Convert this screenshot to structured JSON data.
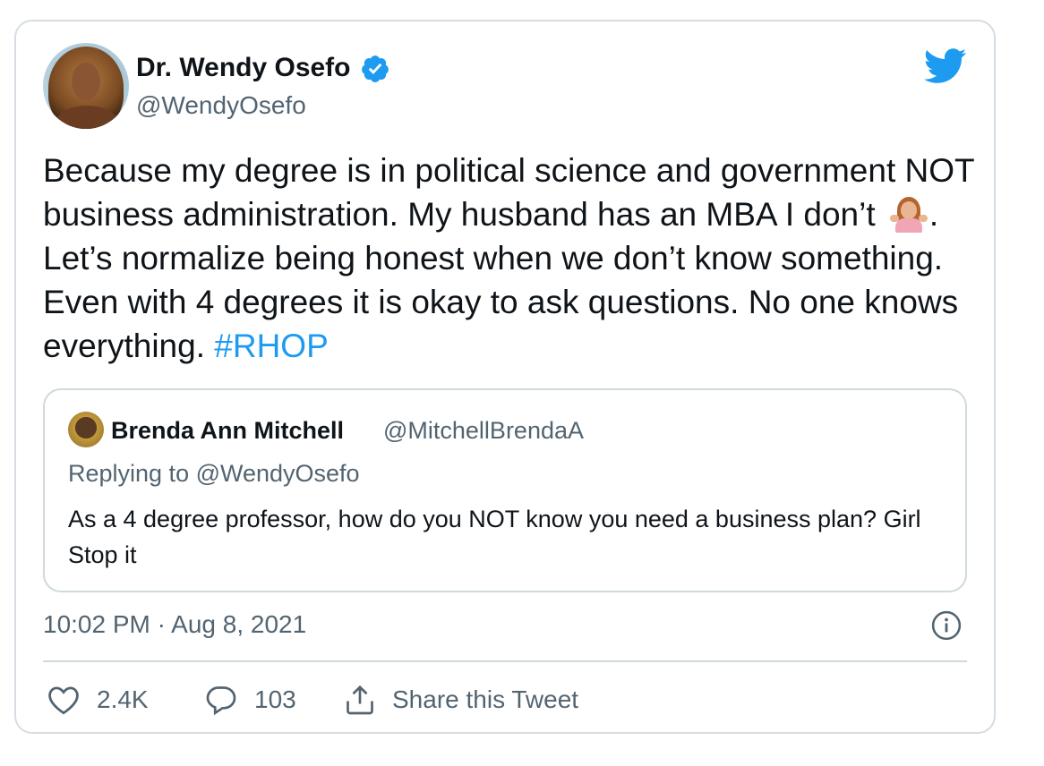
{
  "author": {
    "name": "Dr. Wendy Osefo",
    "handle": "@WendyOsefo",
    "verified": true
  },
  "tweet": {
    "text_before_emoji": "Because my degree is in political science and government NOT business administration. My husband has an MBA I don’t ",
    "emoji": "woman-shrugging-emoji",
    "text_after_emoji": ". Let’s normalize being honest when we don’t know something. Even with 4 degrees it is okay to ask questions. No one knows everything. ",
    "hashtag": "#RHOP"
  },
  "quoted_tweet": {
    "name": "Brenda Ann Mitchell",
    "handle": "@MitchellBrendaA",
    "replying_to": "Replying to @WendyOsefo",
    "text": "As a 4 degree professor, how do you NOT know you need a  business plan? Girl Stop it"
  },
  "timestamp": "10:02 PM · Aug 8, 2021",
  "actions": {
    "likes": "2.4K",
    "replies": "103",
    "share_label": "Share this Tweet"
  },
  "colors": {
    "accent": "#1d9bf0",
    "text": "#0f1419",
    "muted": "#536471",
    "border": "#cfd9de"
  }
}
